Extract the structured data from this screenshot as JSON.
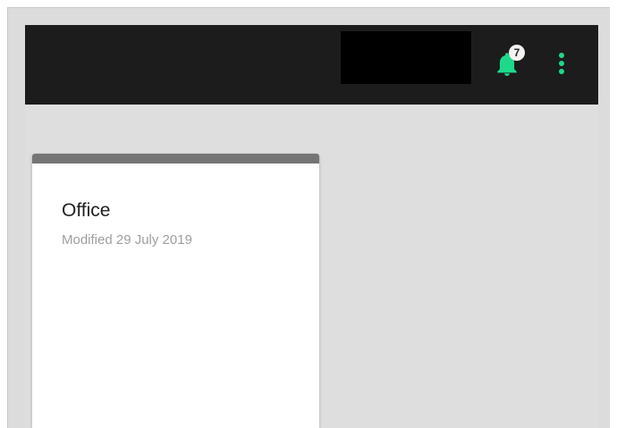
{
  "topbar": {
    "notifications": {
      "count": "7",
      "icon": "bell-icon"
    },
    "menu_icon": "more-vert-icon"
  },
  "card": {
    "title": "Office",
    "modified": "Modified 29 July 2019"
  },
  "colors": {
    "topbar_bg": "#1c1c1c",
    "accent": "#1ed98a",
    "card_strip": "#757575",
    "page_bg": "#dedede"
  }
}
